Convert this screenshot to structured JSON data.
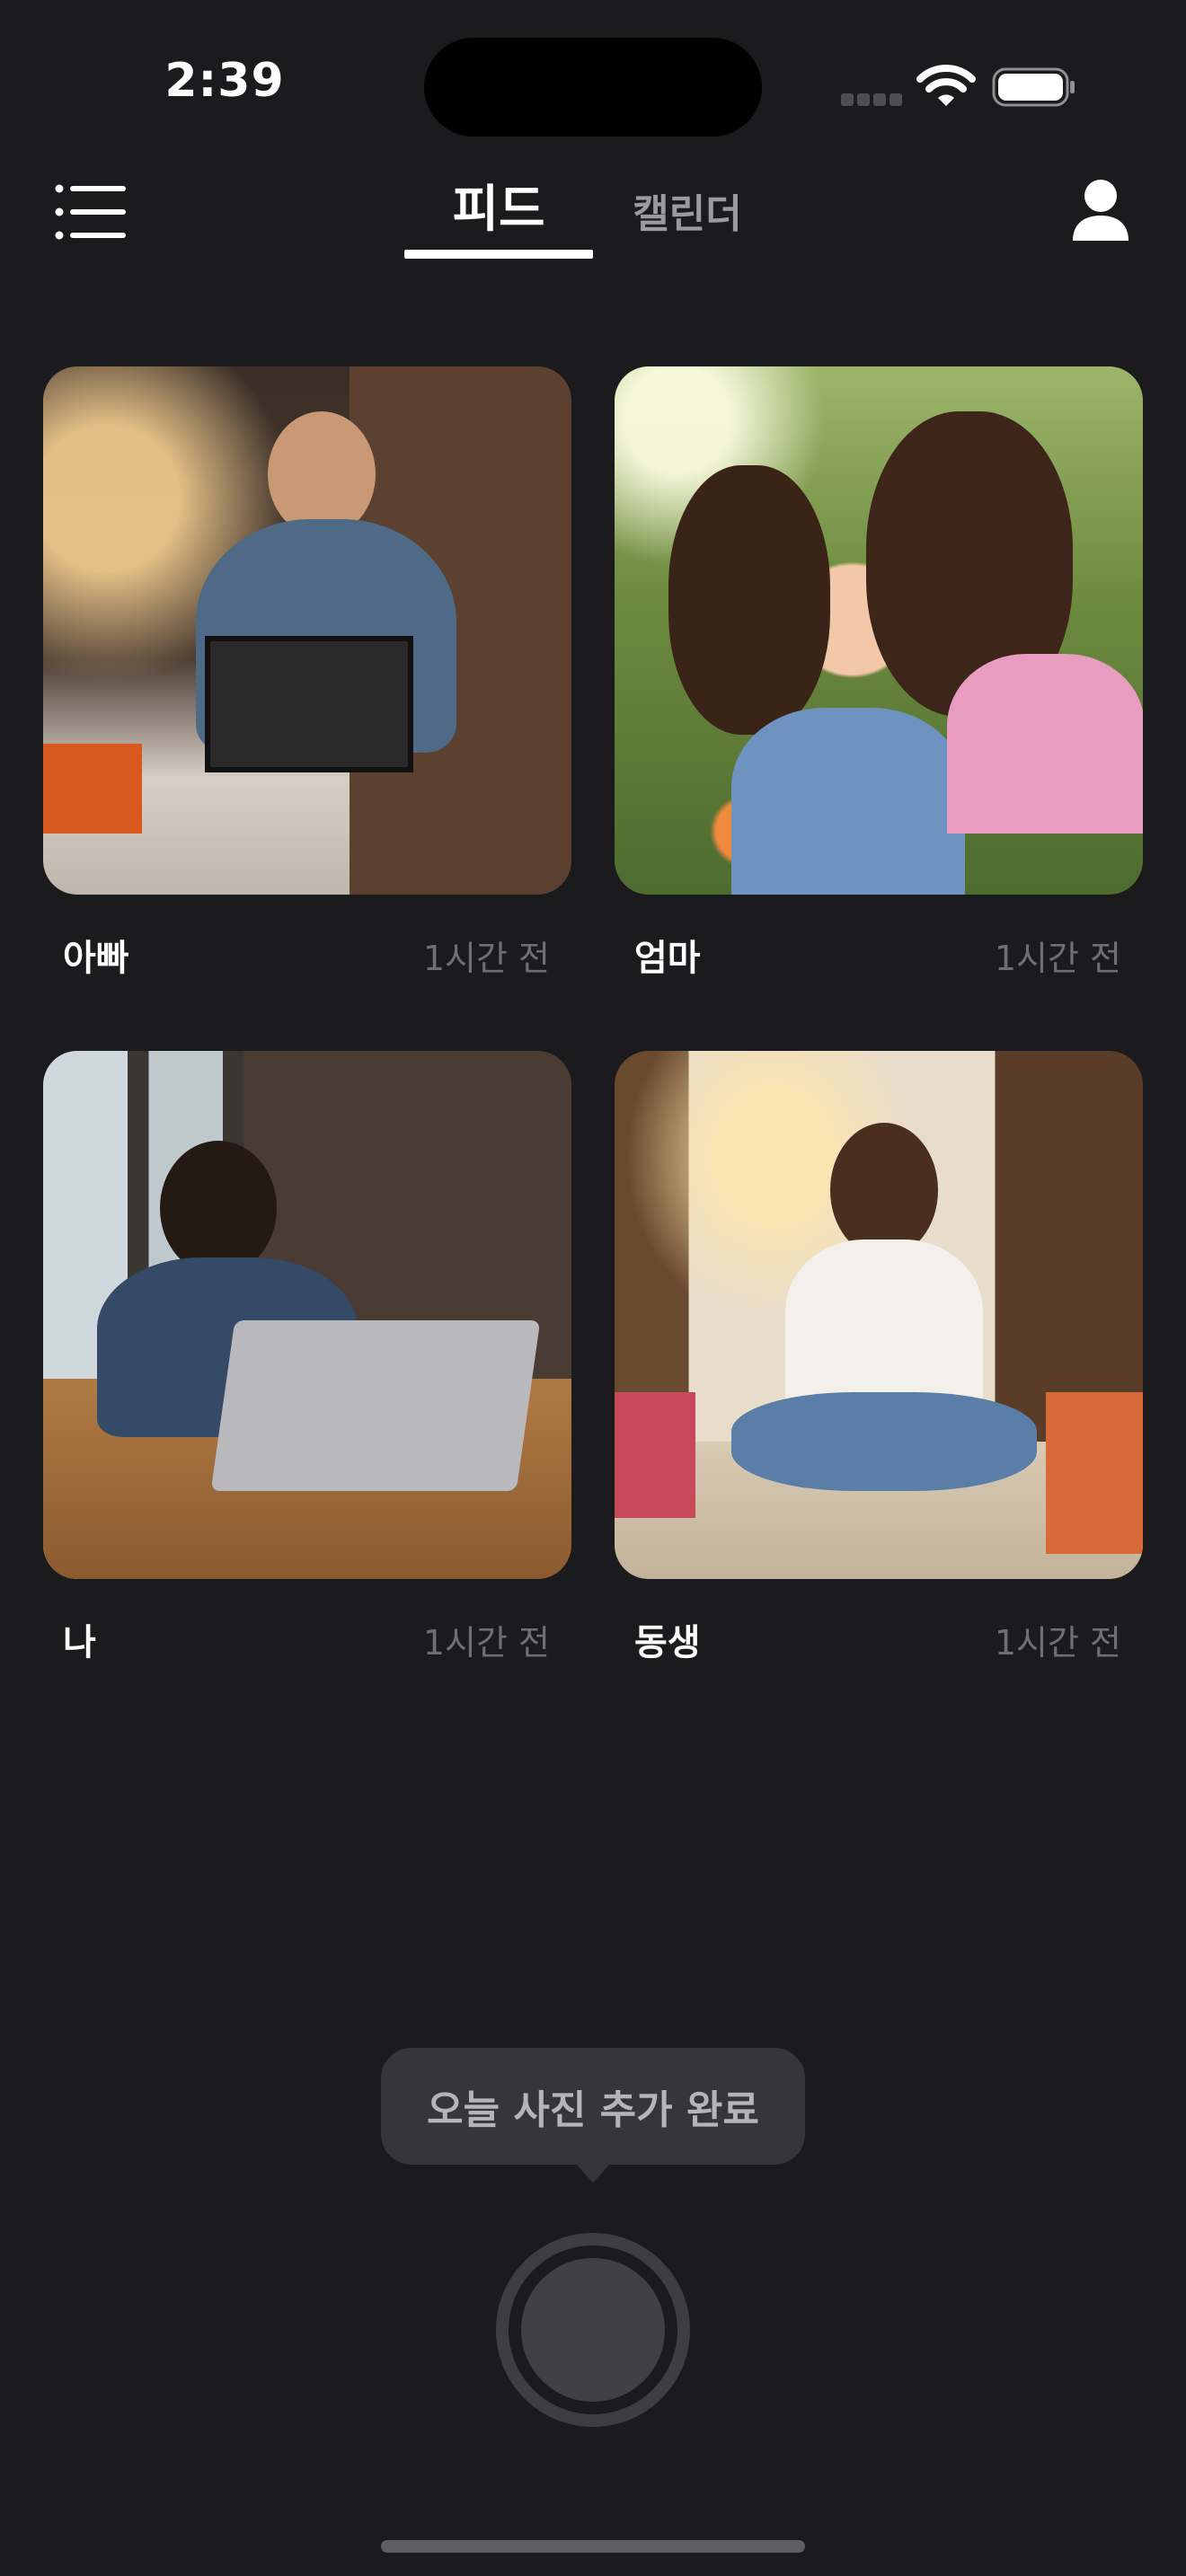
{
  "status_bar": {
    "time": "2:39",
    "icons": [
      "cellular-signal-icon",
      "wifi-icon",
      "battery-icon"
    ]
  },
  "header": {
    "menu_icon": "list-icon",
    "tabs": [
      {
        "label": "피드",
        "selected": true
      },
      {
        "label": "캘린더",
        "selected": false
      }
    ],
    "profile_icon": "person-icon"
  },
  "feed": {
    "cards": [
      {
        "name": "아빠",
        "time": "1시간 전"
      },
      {
        "name": "엄마",
        "time": "1시간 전"
      },
      {
        "name": "나",
        "time": "1시간 전"
      },
      {
        "name": "동생",
        "time": "1시간 전"
      }
    ]
  },
  "tooltip": {
    "text": "오늘 사진 추가 완료"
  },
  "capture": {
    "icon": "shutter-icon"
  },
  "colors": {
    "background": "#1b1b1d",
    "selected_tab": "#ffffff",
    "unselected_tab": "#9a9aa0",
    "timestamp": "#6e6e74",
    "tooltip_bg": "#36363a"
  }
}
